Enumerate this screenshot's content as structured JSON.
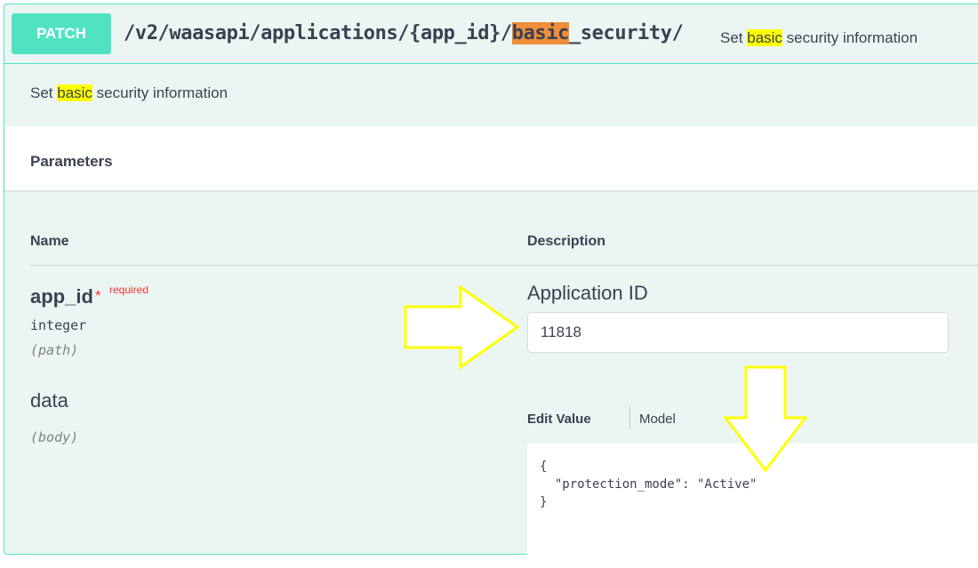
{
  "operation": {
    "method": "PATCH",
    "path_prefix": "/v2/waasapi/applications/{app_id}/",
    "path_highlight": "basic",
    "path_suffix": "_security/",
    "summary_prefix": "Set ",
    "summary_highlight": "basic",
    "summary_suffix": " security information",
    "description_prefix": "Set ",
    "description_highlight": "basic",
    "description_suffix": " security information"
  },
  "parameters": {
    "section_title": "Parameters",
    "col_name": "Name",
    "col_description": "Description",
    "app_id": {
      "name": "app_id",
      "required_star": "*",
      "required_label": "required",
      "type": "integer",
      "in": "(path)",
      "description": "Application ID",
      "value": "11818"
    },
    "data": {
      "name": "data",
      "in": "(body)",
      "tab_edit": "Edit Value",
      "tab_model": "Model",
      "value": "{\n  \"protection_mode\": \"Active\"\n}"
    }
  },
  "annotations": {
    "arrow_color": "#ffff00",
    "right_arrow_icon": "arrow-right-icon",
    "down_arrow_icon": "arrow-down-icon"
  },
  "colors": {
    "patch_accent": "#50e3c2",
    "block_background": "#ebf6f3",
    "highlight_orange": "#f08e3a",
    "highlight_yellow": "#ffff00",
    "required_red": "#ff3333"
  }
}
